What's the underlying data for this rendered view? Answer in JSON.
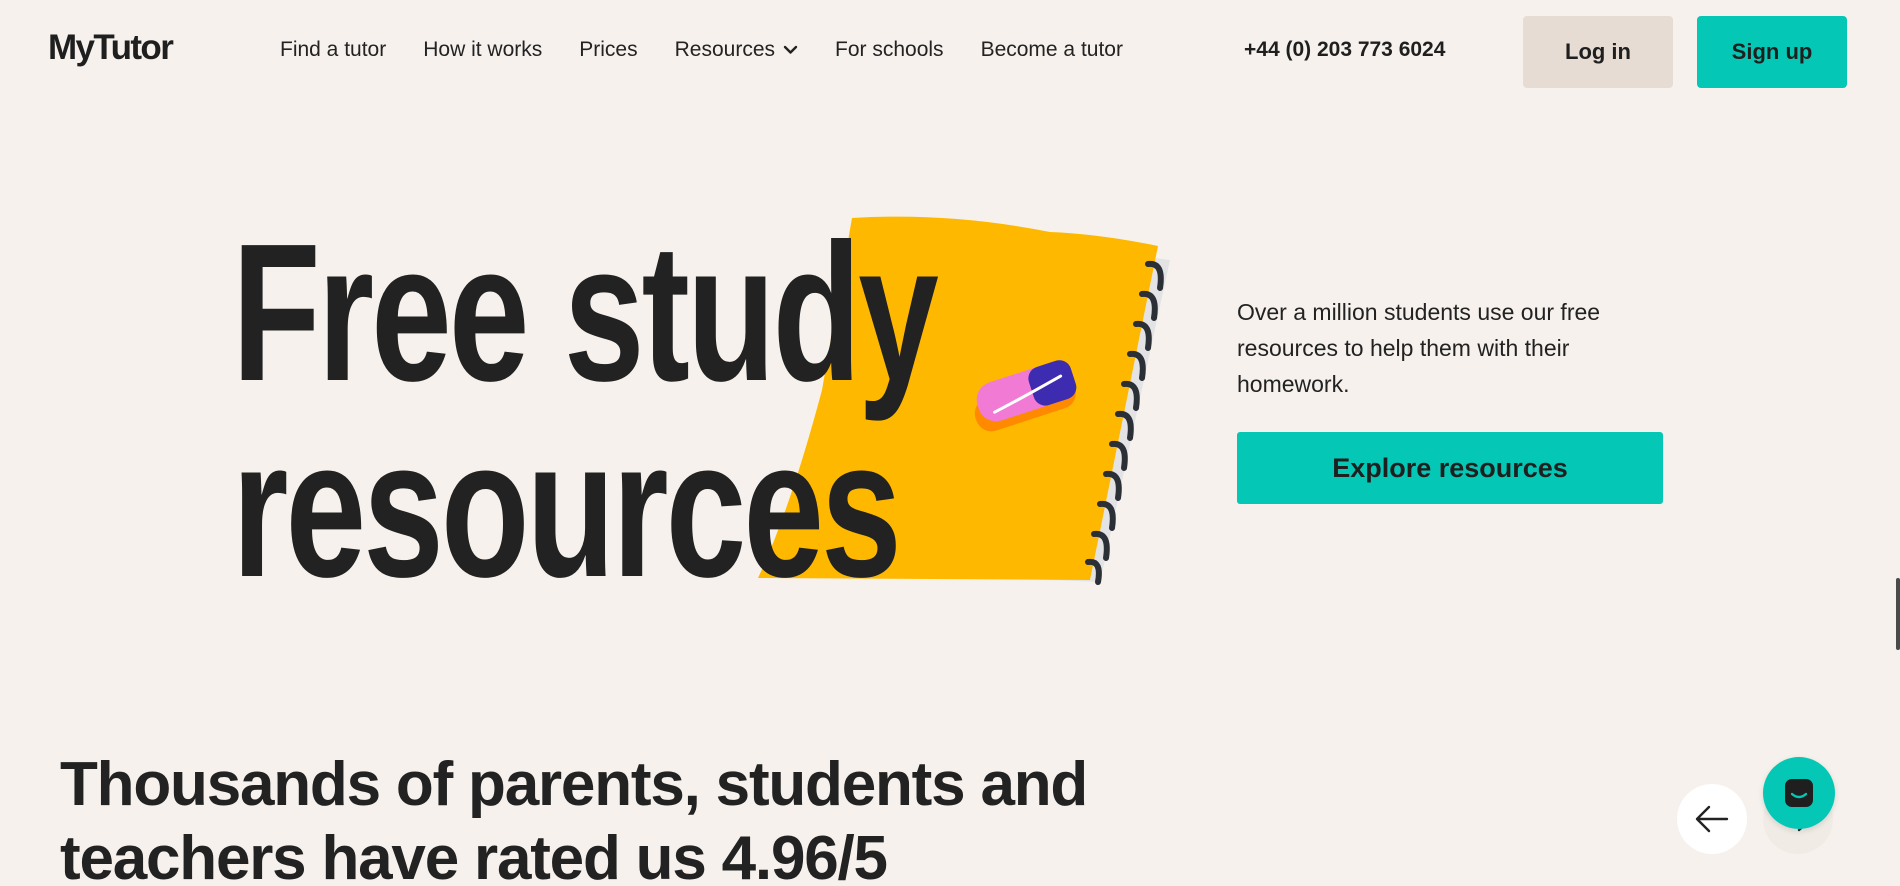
{
  "nav": {
    "logo": "MyTutor",
    "links": [
      "Find a tutor",
      "How it works",
      "Prices",
      "Resources",
      "For schools",
      "Become a tutor"
    ],
    "phone": "+44 (0) 203 773 6024",
    "login_label": "Log in",
    "signup_label": "Sign up"
  },
  "hero": {
    "title_line1": "Free study",
    "title_line2": "resources",
    "description": "Over a million students use our free resources to help them with their homework.",
    "cta_label": "Explore resources"
  },
  "ratings": {
    "title": "Thousands of parents, students and teachers have rated us 4.96/5"
  },
  "icons": {
    "chevron": "chevron-down-icon",
    "prev": "arrow-left-icon",
    "next": "arrow-right-icon",
    "chat": "chat-icon"
  },
  "colors": {
    "background": "#f6f1ec",
    "accent": "#05c7b6",
    "login_bg": "#e7dcd3",
    "notebook": "#ffb800"
  }
}
